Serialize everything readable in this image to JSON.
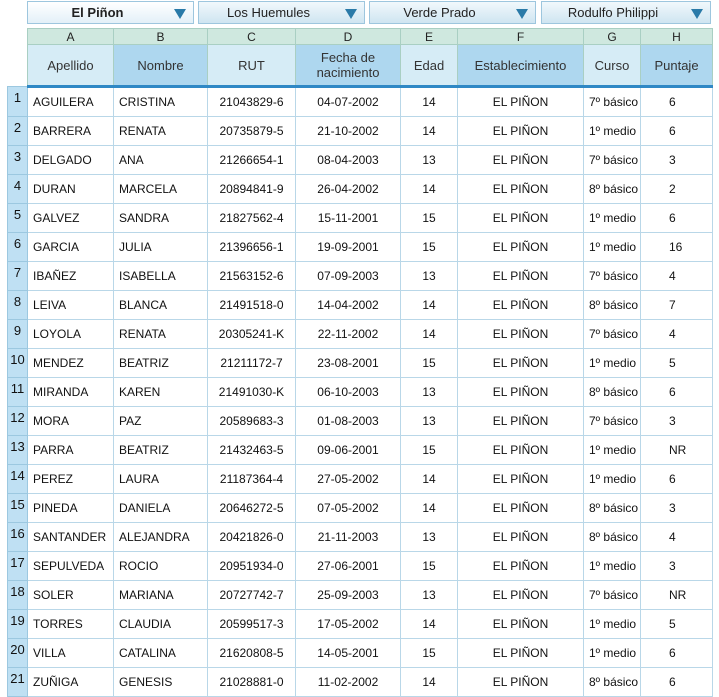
{
  "tabs": [
    {
      "label": "El Piñon",
      "active": true
    },
    {
      "label": "Los Huemules",
      "active": false
    },
    {
      "label": "Verde Prado",
      "active": false
    },
    {
      "label": "Rodulfo Philippi",
      "active": false
    }
  ],
  "columns": {
    "letters": [
      "A",
      "B",
      "C",
      "D",
      "E",
      "F",
      "G",
      "H"
    ],
    "headers": [
      "Apellido",
      "Nombre",
      "RUT",
      "Fecha de nacimiento",
      "Edad",
      "Establecimiento",
      "Curso",
      "Puntaje"
    ]
  },
  "rows": [
    {
      "n": "1",
      "apellido": "AGUILERA",
      "nombre": "CRISTINA",
      "rut": "21043829-6",
      "fecha": "04-07-2002",
      "edad": "14",
      "est": "EL PIÑON",
      "curso": "7º básico",
      "puntaje": "6"
    },
    {
      "n": "2",
      "apellido": "BARRERA",
      "nombre": "RENATA",
      "rut": "20735879-5",
      "fecha": "21-10-2002",
      "edad": "14",
      "est": "EL PIÑON",
      "curso": "1º medio",
      "puntaje": "6"
    },
    {
      "n": "3",
      "apellido": "DELGADO",
      "nombre": "ANA",
      "rut": "21266654-1",
      "fecha": "08-04-2003",
      "edad": "13",
      "est": "EL PIÑON",
      "curso": "7º básico",
      "puntaje": "3"
    },
    {
      "n": "4",
      "apellido": "DURAN",
      "nombre": "MARCELA",
      "rut": "20894841-9",
      "fecha": "26-04-2002",
      "edad": "14",
      "est": "EL PIÑON",
      "curso": "8º básico",
      "puntaje": "2"
    },
    {
      "n": "5",
      "apellido": "GALVEZ",
      "nombre": "SANDRA",
      "rut": "21827562-4",
      "fecha": "15-11-2001",
      "edad": "15",
      "est": "EL PIÑON",
      "curso": "1º medio",
      "puntaje": "6"
    },
    {
      "n": "6",
      "apellido": "GARCIA",
      "nombre": "JULIA",
      "rut": "21396656-1",
      "fecha": "19-09-2001",
      "edad": "15",
      "est": "EL PIÑON",
      "curso": "1º medio",
      "puntaje": "16"
    },
    {
      "n": "7",
      "apellido": "IBAÑEZ",
      "nombre": "ISABELLA",
      "rut": "21563152-6",
      "fecha": "07-09-2003",
      "edad": "13",
      "est": "EL PIÑON",
      "curso": "7º básico",
      "puntaje": "4"
    },
    {
      "n": "8",
      "apellido": "LEIVA",
      "nombre": "BLANCA",
      "rut": "21491518-0",
      "fecha": "14-04-2002",
      "edad": "14",
      "est": "EL PIÑON",
      "curso": "8º básico",
      "puntaje": "7"
    },
    {
      "n": "9",
      "apellido": "LOYOLA",
      "nombre": "RENATA",
      "rut": "20305241-K",
      "fecha": "22-11-2002",
      "edad": "14",
      "est": "EL PIÑON",
      "curso": "7º básico",
      "puntaje": "4"
    },
    {
      "n": "10",
      "apellido": "MENDEZ",
      "nombre": "BEATRIZ",
      "rut": "21211172-7",
      "fecha": "23-08-2001",
      "edad": "15",
      "est": "EL PIÑON",
      "curso": "1º medio",
      "puntaje": "5"
    },
    {
      "n": "11",
      "apellido": "MIRANDA",
      "nombre": "KAREN",
      "rut": "21491030-K",
      "fecha": "06-10-2003",
      "edad": "13",
      "est": "EL PIÑON",
      "curso": "8º básico",
      "puntaje": "6"
    },
    {
      "n": "12",
      "apellido": "MORA",
      "nombre": "PAZ",
      "rut": "20589683-3",
      "fecha": "01-08-2003",
      "edad": "13",
      "est": "EL PIÑON",
      "curso": "7º básico",
      "puntaje": "3"
    },
    {
      "n": "13",
      "apellido": "PARRA",
      "nombre": "BEATRIZ",
      "rut": "21432463-5",
      "fecha": "09-06-2001",
      "edad": "15",
      "est": "EL PIÑON",
      "curso": "1º medio",
      "puntaje": "NR"
    },
    {
      "n": "14",
      "apellido": "PEREZ",
      "nombre": "LAURA",
      "rut": "21187364-4",
      "fecha": "27-05-2002",
      "edad": "14",
      "est": "EL PIÑON",
      "curso": "1º medio",
      "puntaje": "6"
    },
    {
      "n": "15",
      "apellido": "PINEDA",
      "nombre": "DANIELA",
      "rut": "20646272-5",
      "fecha": "07-05-2002",
      "edad": "14",
      "est": "EL PIÑON",
      "curso": "8º básico",
      "puntaje": "3"
    },
    {
      "n": "16",
      "apellido": "SANTANDER",
      "nombre": "ALEJANDRA",
      "rut": "20421826-0",
      "fecha": "21-11-2003",
      "edad": "13",
      "est": "EL PIÑON",
      "curso": "8º básico",
      "puntaje": "4"
    },
    {
      "n": "17",
      "apellido": "SEPULVEDA",
      "nombre": "ROCIO",
      "rut": "20951934-0",
      "fecha": "27-06-2001",
      "edad": "15",
      "est": "EL PIÑON",
      "curso": "1º medio",
      "puntaje": "3"
    },
    {
      "n": "18",
      "apellido": "SOLER",
      "nombre": "MARIANA",
      "rut": "20727742-7",
      "fecha": "25-09-2003",
      "edad": "13",
      "est": "EL PIÑON",
      "curso": "7º básico",
      "puntaje": "NR"
    },
    {
      "n": "19",
      "apellido": "TORRES",
      "nombre": "CLAUDIA",
      "rut": "20599517-3",
      "fecha": "17-05-2002",
      "edad": "14",
      "est": "EL PIÑON",
      "curso": "1º medio",
      "puntaje": "5"
    },
    {
      "n": "20",
      "apellido": "VILLA",
      "nombre": "CATALINA",
      "rut": "21620808-5",
      "fecha": "14-05-2001",
      "edad": "15",
      "est": "EL PIÑON",
      "curso": "1º medio",
      "puntaje": "6"
    },
    {
      "n": "21",
      "apellido": "ZUÑIGA",
      "nombre": "GENESIS",
      "rut": "21028881-0",
      "fecha": "11-02-2002",
      "edad": "14",
      "est": "EL PIÑON",
      "curso": "8º básico",
      "puntaje": "6"
    }
  ],
  "colors": {
    "header_light": "#d6ecf6",
    "header_dark": "#aed7ef",
    "letter_row": "#cfe8df",
    "row_number": "#bfe0f3",
    "accent": "#2f88c5"
  }
}
